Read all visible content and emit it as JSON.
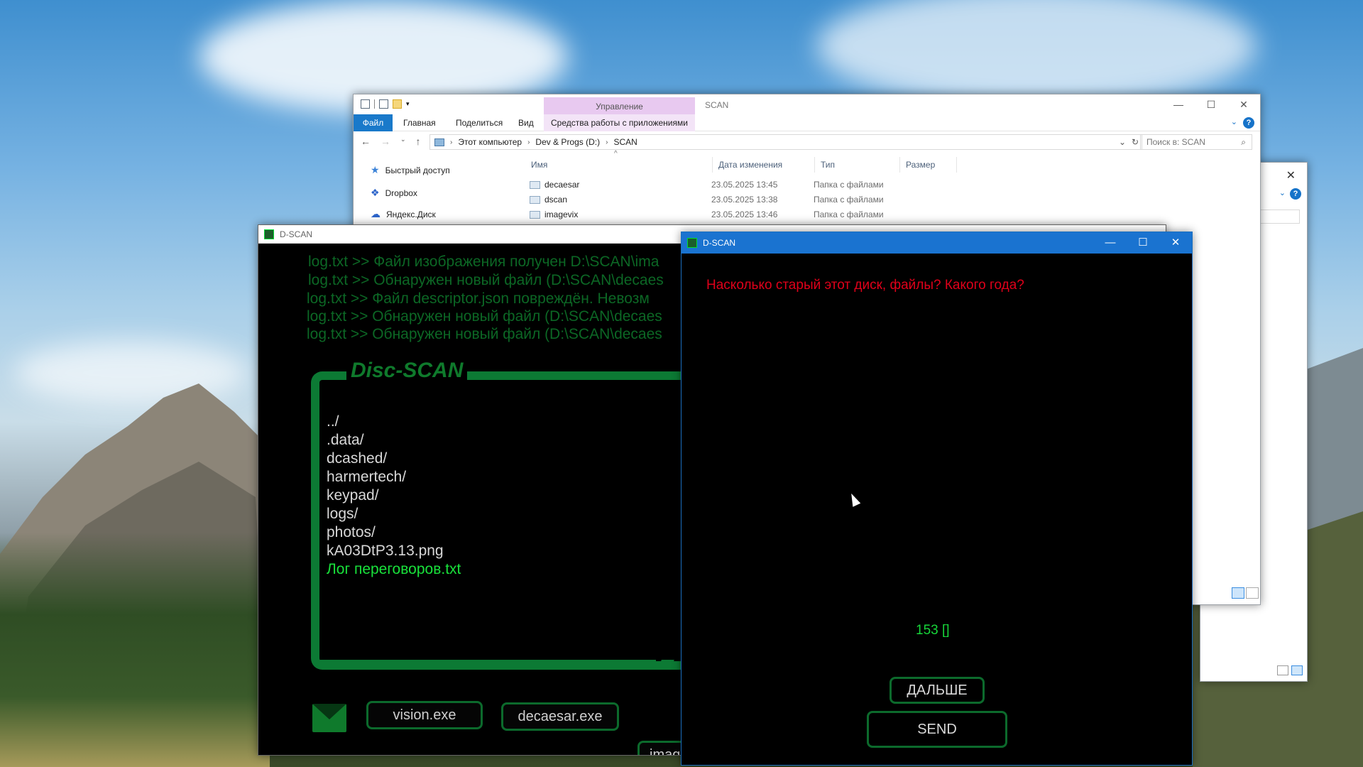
{
  "explorer": {
    "title": "SCAN",
    "contextual_tab": "Управление",
    "ribbon_tabs": [
      "Файл",
      "Главная",
      "Поделиться",
      "Вид"
    ],
    "contextual_tools": "Средства работы с приложениями",
    "breadcrumb": [
      "Этот компьютер",
      "Dev & Progs (D:)",
      "SCAN"
    ],
    "search_placeholder": "Поиск в: SCAN",
    "nav_items": [
      "Быстрый доступ",
      "Dropbox",
      "Яндекс.Диск"
    ],
    "columns": [
      "Имя",
      "Дата изменения",
      "Тип",
      "Размер"
    ],
    "rows": [
      {
        "name": "decaesar",
        "date": "23.05.2025 13:45",
        "type": "Папка с файлами"
      },
      {
        "name": "dscan",
        "date": "23.05.2025 13:38",
        "type": "Папка с файлами"
      },
      {
        "name": "imagevix",
        "date": "23.05.2025 13:46",
        "type": "Папка с файлами"
      }
    ]
  },
  "dscan_main": {
    "title": "D-SCAN",
    "logs": [
      "log.txt >> Файл изображения получен D:\\SCAN\\ima",
      "log.txt >> Обнаружен новый файл (D:\\SCAN\\decaes",
      "log.txt >> Файл descriptor.json повреждён. Невозм",
      "log.txt >> Обнаружен новый файл (D:\\SCAN\\decaes",
      "log.txt >> Обнаружен новый файл (D:\\SCAN\\decaes"
    ],
    "panel_title": "Disc-SCAN",
    "files": [
      "../",
      ".data/",
      "dcashed/",
      "harmertech/",
      "keypad/",
      "logs/",
      "photos/",
      "kA03DtP3.13.png"
    ],
    "highlighted_file": "Лог переговоров.txt",
    "buttons": [
      "vision.exe",
      "decaesar.exe",
      "imag"
    ]
  },
  "dscan_dialog": {
    "title": "D-SCAN",
    "question": "Насколько старый этот диск, файлы? Какого года?",
    "input_value": "153 []",
    "next_label": "ДАЛЬШЕ",
    "send_label": "SEND"
  },
  "colors": {
    "accent_green": "#0c7a34",
    "bright_green": "#19e23b",
    "question_red": "#e0001a",
    "title_blue": "#1a73d0"
  }
}
